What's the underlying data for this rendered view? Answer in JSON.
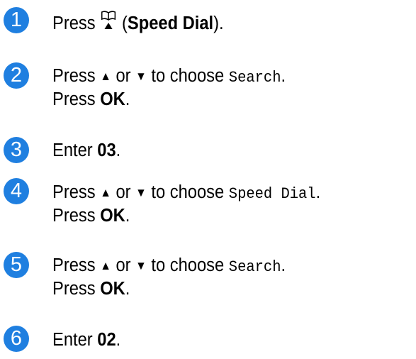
{
  "accent_color": "#1f7fe0",
  "steps": [
    {
      "number": "1",
      "press": "Press",
      "icon": "speed-dial-book-icon",
      "open_paren": " (",
      "key": "Speed Dial",
      "close": ")."
    },
    {
      "number": "2",
      "press": "Press",
      "up": "▲",
      "or": " or ",
      "down": "▼",
      "to_choose": " to choose ",
      "option": "Search",
      "end": ".",
      "press2": "Press ",
      "ok": "OK",
      "end2": "."
    },
    {
      "number": "3",
      "enter": "Enter ",
      "value": "03",
      "end": "."
    },
    {
      "number": "4",
      "press": "Press",
      "up": "▲",
      "or": " or ",
      "down": "▼",
      "to_choose": " to choose ",
      "option": "Speed Dial",
      "end": ".",
      "press2": "Press ",
      "ok": "OK",
      "end2": "."
    },
    {
      "number": "5",
      "press": "Press",
      "up": "▲",
      "or": " or ",
      "down": "▼",
      "to_choose": " to choose ",
      "option": "Search",
      "end": ".",
      "press2": "Press ",
      "ok": "OK",
      "end2": "."
    },
    {
      "number": "6",
      "enter": "Enter ",
      "value": "02",
      "end": "."
    }
  ]
}
